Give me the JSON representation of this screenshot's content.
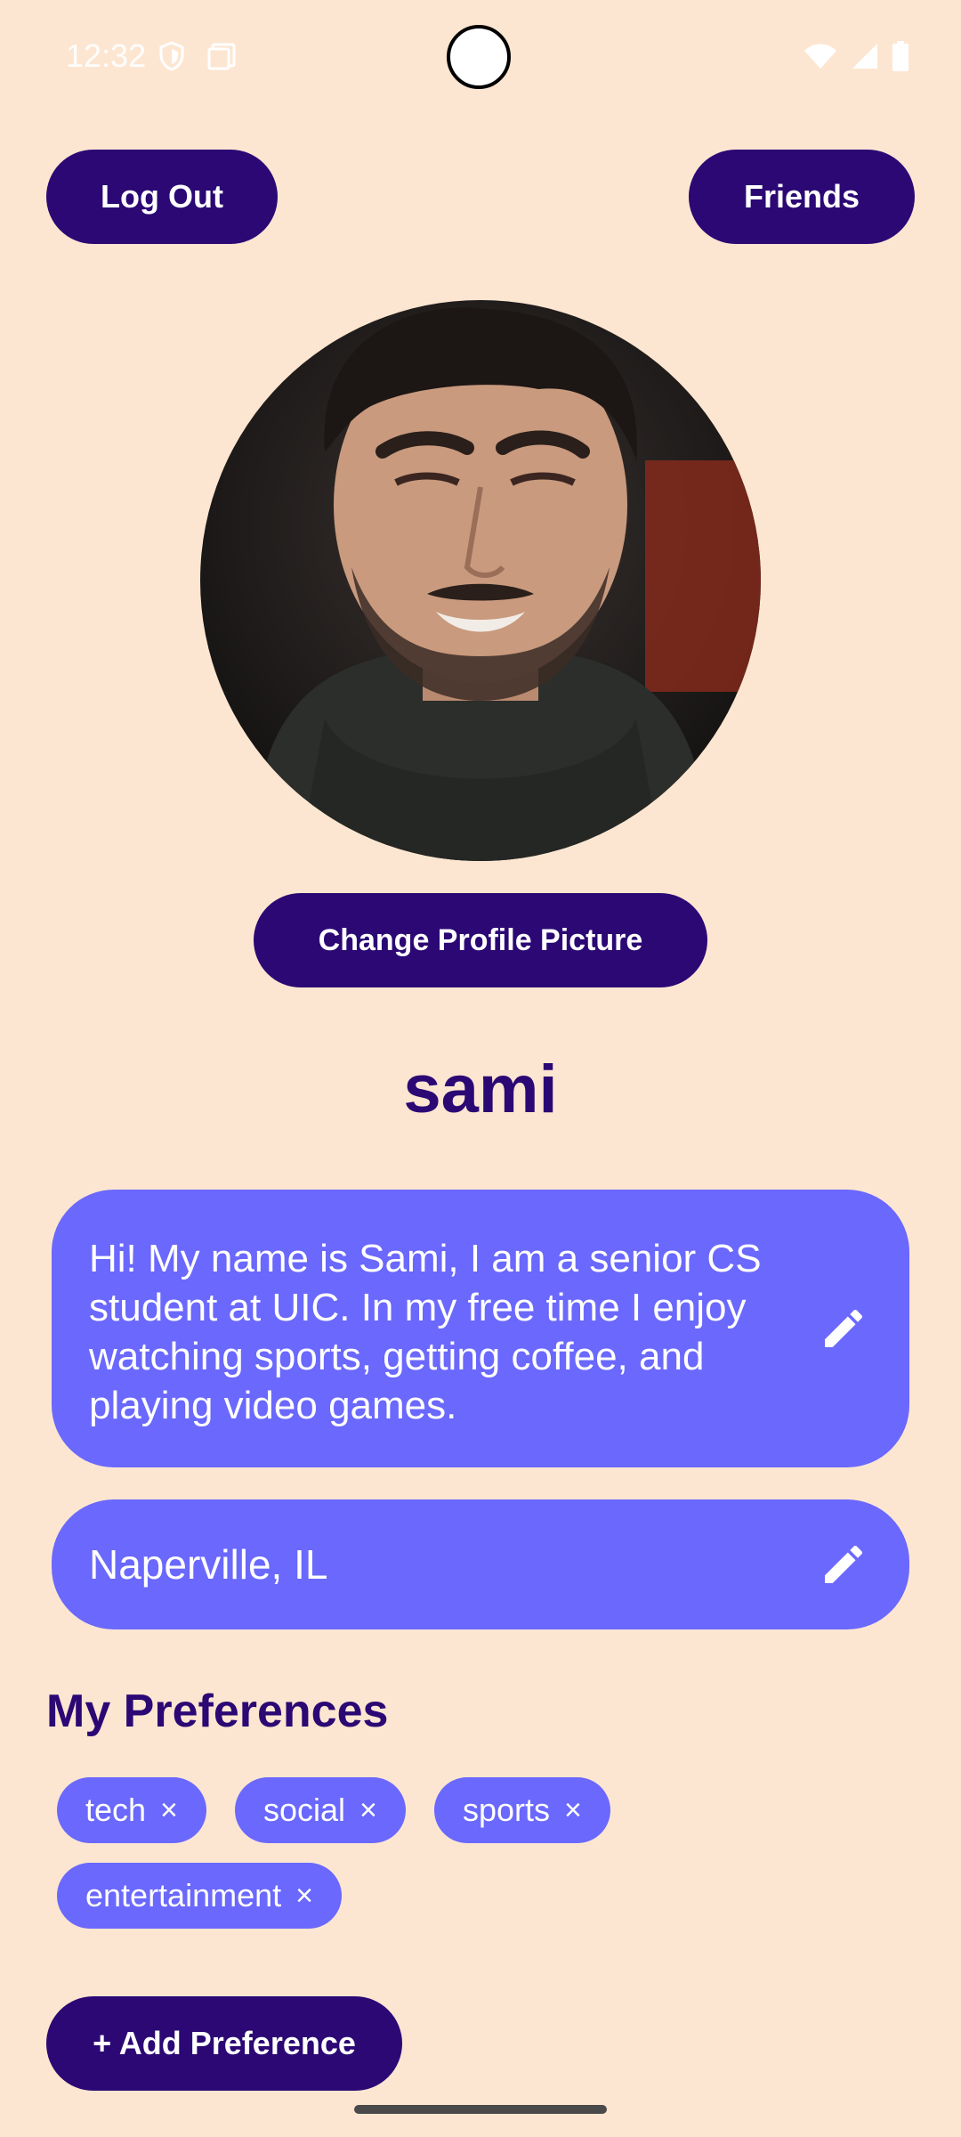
{
  "status_bar": {
    "time": "12:32",
    "icons_left": [
      "shield-icon",
      "screenshot-icon"
    ],
    "icons_right": [
      "wifi-icon",
      "signal-icon",
      "battery-icon"
    ]
  },
  "header": {
    "logout_label": "Log Out",
    "friends_label": "Friends"
  },
  "profile": {
    "change_picture_label": "Change Profile Picture",
    "username": "sami",
    "bio": "Hi! My name is Sami, I am a senior CS student at UIC. In my free time I enjoy watching sports, getting coffee, and playing video games.",
    "location": "Naperville, IL"
  },
  "preferences": {
    "title": "My Preferences",
    "chips": [
      {
        "label": "tech",
        "remove": "×"
      },
      {
        "label": "social",
        "remove": "×"
      },
      {
        "label": "sports",
        "remove": "×"
      },
      {
        "label": "entertainment",
        "remove": "×"
      }
    ],
    "add_label": "+ Add Preference"
  },
  "colors": {
    "background": "#FDE6D1",
    "primary": "#2B0874",
    "card": "#6A68FD"
  }
}
